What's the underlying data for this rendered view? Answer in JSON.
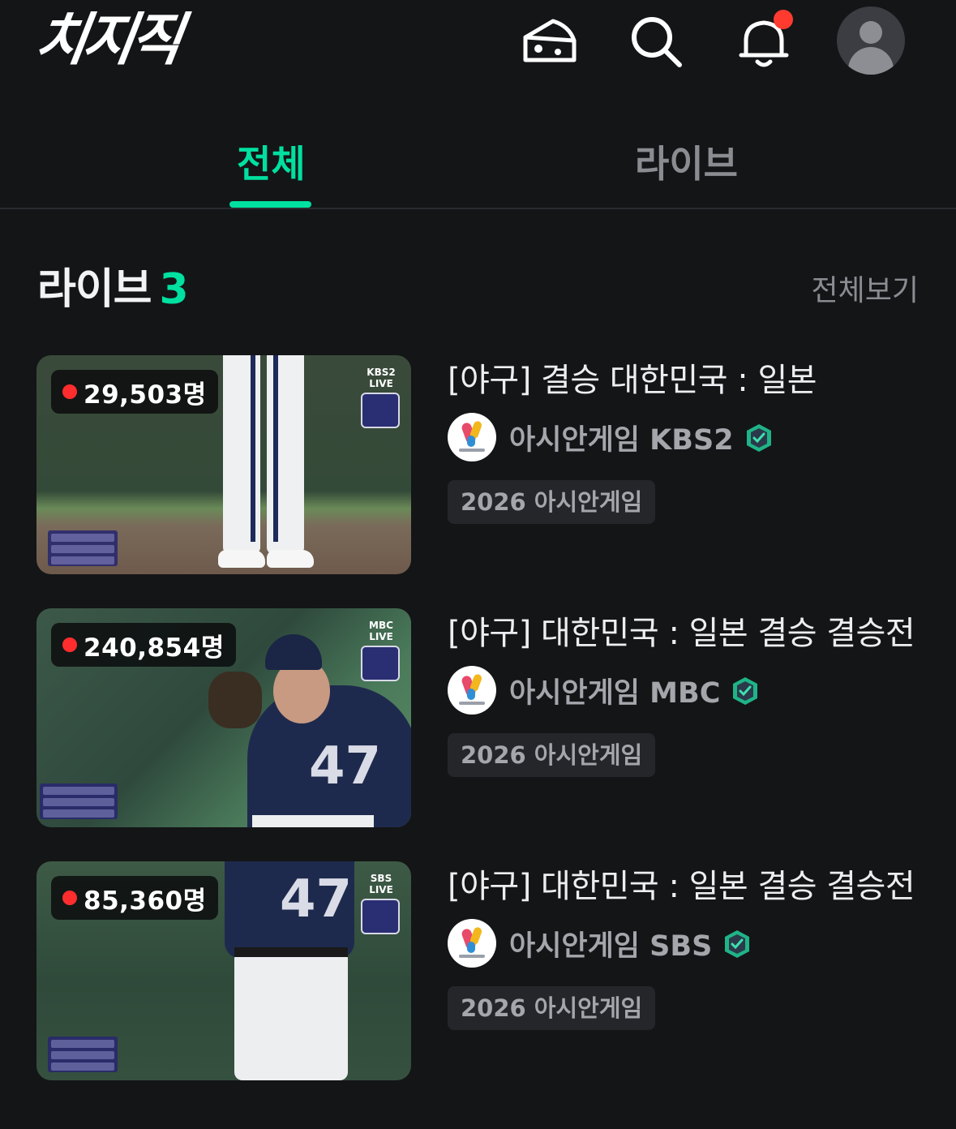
{
  "app": {
    "logo": "치지직"
  },
  "header": {
    "icons": [
      "cheese-icon",
      "search-icon",
      "bell-icon",
      "avatar"
    ]
  },
  "tabs": [
    {
      "label": "전체",
      "active": true
    },
    {
      "label": "라이브",
      "active": false
    }
  ],
  "section": {
    "title": "라이브",
    "count": "3",
    "see_all": "전체보기"
  },
  "streams": [
    {
      "viewers": "29,503명",
      "broadcaster": "KBS2 LIVE",
      "title": "[야구] 결승 대한민국 : 일본",
      "channel": "아시안게임 KBS2",
      "tag": "2026 아시안게임"
    },
    {
      "viewers": "240,854명",
      "broadcaster": "MBC LIVE",
      "title": "[야구] 대한민국 : 일본 결승 결승전",
      "channel": "아시안게임 MBC",
      "tag": "2026 아시안게임"
    },
    {
      "viewers": "85,360명",
      "broadcaster": "SBS LIVE",
      "title": "[야구] 대한민국 : 일본 결승 결승전",
      "channel": "아시안게임 SBS",
      "tag": "2026 아시안게임"
    }
  ],
  "colors": {
    "accent": "#00e0a0",
    "background": "#141517",
    "live_dot": "#ff2d2d",
    "notification_dot": "#ff3b30"
  }
}
